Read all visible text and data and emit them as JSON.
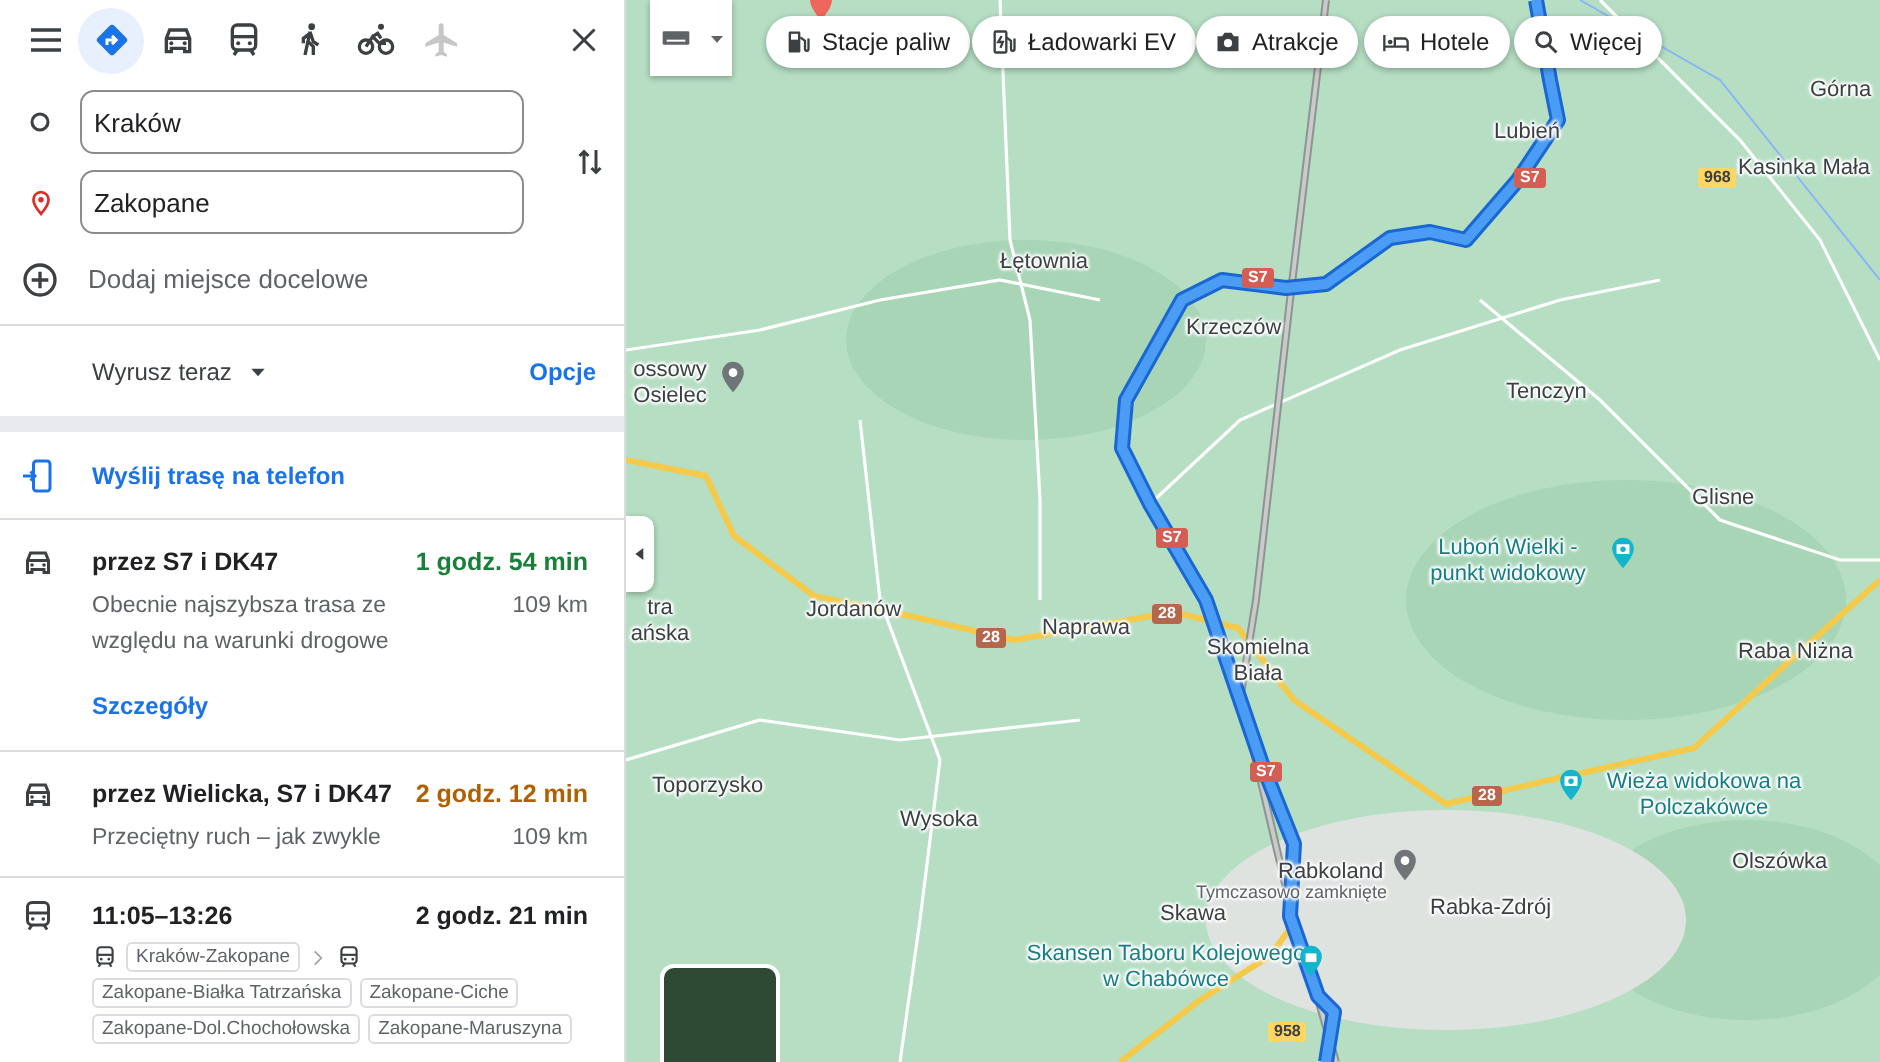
{
  "travel_modes": [
    {
      "kind": "best",
      "selected": true,
      "disabled": false
    },
    {
      "kind": "car",
      "selected": false,
      "disabled": false
    },
    {
      "kind": "transit",
      "selected": false,
      "disabled": false
    },
    {
      "kind": "walk",
      "selected": false,
      "disabled": false
    },
    {
      "kind": "bike",
      "selected": false,
      "disabled": false
    },
    {
      "kind": "flight",
      "selected": false,
      "disabled": true
    }
  ],
  "origin": {
    "value": "Kraków"
  },
  "destination": {
    "value": "Zakopane"
  },
  "add_destination": "Dodaj miejsce docelowe",
  "depart": "Wyrusz teraz",
  "options": "Opcje",
  "send_to_phone": "Wyślij trasę na telefon",
  "routes": [
    {
      "kind": "car",
      "title": "przez S7 i DK47",
      "duration": "1 godz. 54 min",
      "color": "#188038",
      "description": "Obecnie najszybsza trasa ze względu na warunki drogowe",
      "distance": "109 km",
      "details": "Szczegóły"
    },
    {
      "kind": "car",
      "title": "przez Wielicka, S7 i DK47",
      "duration": "2 godz. 12 min",
      "color": "#b06000",
      "description": "Przeciętny ruch – jak zwykle",
      "distance": "109 km"
    },
    {
      "kind": "transit",
      "title": "11:05–13:26",
      "duration": "2 godz. 21 min",
      "color": "#202124",
      "legs": [
        {
          "kind": "bus",
          "lines": [
            "Kraków-Zakopane"
          ]
        },
        {
          "kind": "bus",
          "lines": [
            "Zakopane-Białka Tatrzańska",
            "Zakopane-Ciche",
            "Zakopane-Dol.Chochołowska",
            "Zakopane-Maruszyna"
          ]
        }
      ]
    }
  ],
  "map": {
    "chips": [
      {
        "kind": "fuel",
        "label": "Stacje paliw"
      },
      {
        "kind": "ev",
        "label": "Ładowarki EV"
      },
      {
        "kind": "camera",
        "label": "Atrakcje"
      },
      {
        "kind": "bed",
        "label": "Hotele"
      },
      {
        "kind": "search",
        "label": "Więcej"
      }
    ],
    "places": [
      {
        "kind": "town",
        "text": "Górna"
      },
      {
        "kind": "town",
        "text": "Lubień"
      },
      {
        "kind": "town",
        "text": "Kasinka Mała"
      },
      {
        "kind": "town",
        "text": "Łętownia"
      },
      {
        "kind": "town",
        "text": "Krzeczów"
      },
      {
        "kind": "place",
        "text": "ossowy Osielec"
      },
      {
        "kind": "town",
        "text": "Tenczyn"
      },
      {
        "kind": "town",
        "text": "Glisne"
      },
      {
        "kind": "viewpoint",
        "text": "Luboń Wielki - punkt widokowy"
      },
      {
        "kind": "town",
        "text": "tra ańska"
      },
      {
        "kind": "town",
        "text": "Jordanów"
      },
      {
        "kind": "town",
        "text": "Naprawa"
      },
      {
        "kind": "town",
        "text": "Skomielna Biała"
      },
      {
        "kind": "town",
        "text": "Raba Niżna"
      },
      {
        "kind": "town",
        "text": "Toporzysko"
      },
      {
        "kind": "town",
        "text": "Wysoka"
      },
      {
        "kind": "viewpoint",
        "text": "Wieża widokowa na Polczakówce"
      },
      {
        "kind": "place",
        "text": "Rabkoland"
      },
      {
        "kind": "note",
        "text": "Tymczasowo zamknięte"
      },
      {
        "kind": "town",
        "text": "Rabka-Zdrój"
      },
      {
        "kind": "town",
        "text": "Olszówka"
      },
      {
        "kind": "town",
        "text": "Skawa"
      },
      {
        "kind": "museum",
        "text": "Skansen Taboru Kolejowego w Chabówce"
      }
    ],
    "road_signs": [
      {
        "kind": "expressway",
        "text": "S7"
      },
      {
        "kind": "expressway",
        "text": "S7"
      },
      {
        "kind": "expressway",
        "text": "S7"
      },
      {
        "kind": "expressway",
        "text": "S7"
      },
      {
        "kind": "regional",
        "text": "968"
      },
      {
        "kind": "national",
        "text": "28"
      },
      {
        "kind": "national",
        "text": "28"
      },
      {
        "kind": "national",
        "text": "28"
      },
      {
        "kind": "regional",
        "text": "958"
      }
    ]
  }
}
